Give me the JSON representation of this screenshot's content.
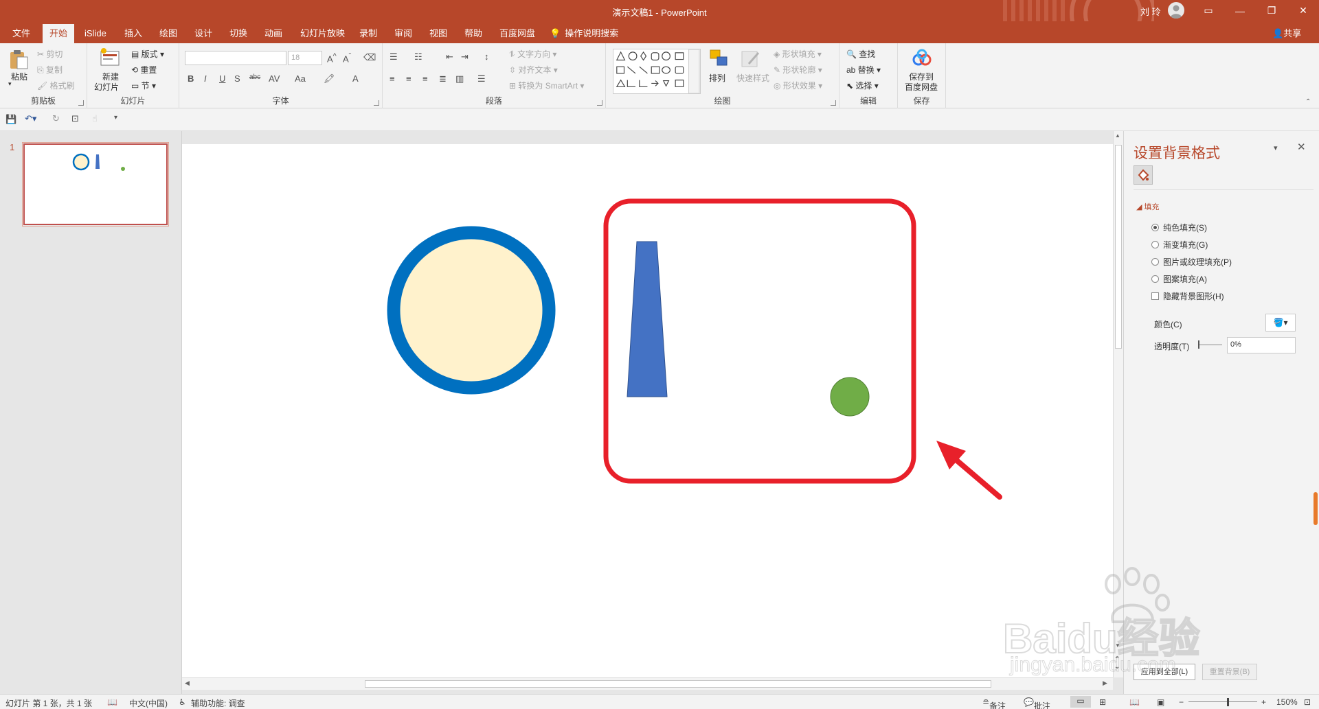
{
  "titlebar": {
    "title": "演示文稿1  -  PowerPoint",
    "user": "刘 玲",
    "accent_color": "#b7472a"
  },
  "tabs": [
    {
      "label": "文件"
    },
    {
      "label": "开始",
      "active": true
    },
    {
      "label": "iSlide"
    },
    {
      "label": "插入"
    },
    {
      "label": "绘图"
    },
    {
      "label": "设计"
    },
    {
      "label": "切换"
    },
    {
      "label": "动画"
    },
    {
      "label": "幻灯片放映"
    },
    {
      "label": "录制"
    },
    {
      "label": "审阅"
    },
    {
      "label": "视图"
    },
    {
      "label": "帮助"
    },
    {
      "label": "百度网盘"
    }
  ],
  "tell_me": "操作说明搜索",
  "share": "共享",
  "ribbon": {
    "clipboard": {
      "label": "剪贴板",
      "paste": "粘贴",
      "cut": "剪切",
      "copy": "复制",
      "format_painter": "格式刷"
    },
    "slides": {
      "label": "幻灯片",
      "new_slide_1": "新建",
      "new_slide_2": "幻灯片",
      "layout": "版式",
      "reset": "重置",
      "section": "节"
    },
    "font": {
      "label": "字体",
      "size_placeholder": "18"
    },
    "paragraph": {
      "label": "段落",
      "text_direction": "文字方向",
      "align_text": "对齐文本",
      "smartart": "转换为 SmartArt"
    },
    "drawing": {
      "label": "绘图",
      "arrange": "排列",
      "quick_styles": "快速样式",
      "shape_fill": "形状填充",
      "shape_outline": "形状轮廓",
      "shape_effects": "形状效果"
    },
    "editing": {
      "label": "编辑",
      "find": "查找",
      "replace": "替换",
      "select": "选择"
    },
    "save": {
      "label": "保存",
      "save_to_1": "保存到",
      "save_to_2": "百度网盘"
    }
  },
  "thumbnail": {
    "number": "1"
  },
  "slide": {
    "shapes": [
      "circle-light-yellow-blue-outline",
      "blue-trapezoid",
      "green-circle"
    ],
    "colors": {
      "circle_fill": "#fff2cc",
      "circle_outline": "#0070c0",
      "trapezoid": "#4472c4",
      "green": "#70ad47",
      "annotation": "#e8202a"
    }
  },
  "format_pane": {
    "title": "设置背景格式",
    "section": "填充",
    "options": [
      {
        "label": "纯色填充(S)",
        "selected": true
      },
      {
        "label": "渐变填充(G)",
        "selected": false
      },
      {
        "label": "图片或纹理填充(P)",
        "selected": false
      },
      {
        "label": "图案填充(A)",
        "selected": false
      }
    ],
    "hide_bg": "隐藏背景图形(H)",
    "color_label": "颜色(C)",
    "transparency_label": "透明度(T)",
    "transparency_value": "0%",
    "apply_all": "应用到全部(L)",
    "reset_bg": "重置背景(B)"
  },
  "watermark": {
    "brand": "Baidu经验",
    "url": "jingyan.baidu.com"
  },
  "status": {
    "slide_info": "幻灯片 第 1 张，共 1 张",
    "language": "中文(中国)",
    "accessibility": "辅助功能: 调查",
    "notes": "备注",
    "comments": "批注",
    "zoom": "150%"
  }
}
